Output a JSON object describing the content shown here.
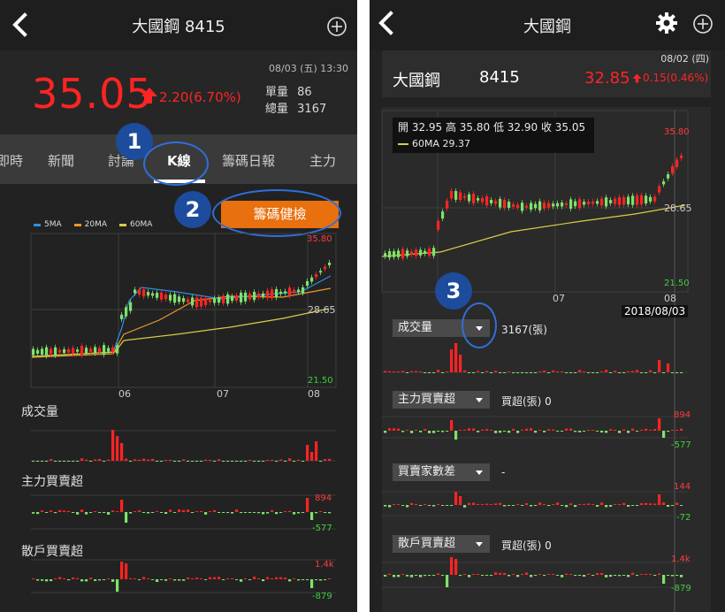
{
  "left": {
    "header": {
      "title": "大國鋼 8415"
    },
    "quote": {
      "price": "35.05",
      "change": "2.20(6.70%)",
      "datetime": "08/03 (五) 13:30",
      "unit_volume_label": "單量",
      "unit_volume": "86",
      "total_volume_label": "總量",
      "total_volume": "3167"
    },
    "tabs": [
      {
        "label": "即時"
      },
      {
        "label": "新聞"
      },
      {
        "label": "討論"
      },
      {
        "label": "K線"
      },
      {
        "label": "籌碼日報"
      },
      {
        "label": "主力"
      }
    ],
    "badges": [
      "1",
      "2"
    ],
    "chip_check_button": "籌碼健檢",
    "legend": [
      "5MA",
      "20MA",
      "60MA"
    ],
    "price_axis": {
      "high": "35.80",
      "mid": "28.65",
      "low": "21.50"
    },
    "x_ticks": [
      "06",
      "07",
      "08"
    ],
    "sections": [
      "成交量",
      "主力買賣超",
      "散戶買賣超"
    ],
    "main_force_axis": {
      "high": "894",
      "low": "-577"
    },
    "retail_axis": {
      "high": "1.4k",
      "low": "-879"
    }
  },
  "right": {
    "header": {
      "title": "大國鋼"
    },
    "info": {
      "date": "08/02 (四)",
      "name": "大國鋼",
      "code": "8415",
      "price": "32.85",
      "change": "0.15(0.46%)"
    },
    "ohlc": "開 32.95 高 35.80 低 32.90 收 35.05",
    "ma60": "60MA 29.37",
    "price_axis": {
      "high": "35.80",
      "mid": "28.65",
      "low": "21.50"
    },
    "x_ticks": [
      "07",
      "08"
    ],
    "badge": "3",
    "date_tag": "2018/08/03",
    "volume_dropdown": {
      "label": "成交量",
      "value": "3167(張)"
    },
    "main_force_dropdown": {
      "label": "主力買賣超",
      "value": "買超(張) 0",
      "high": "894",
      "low": "-577"
    },
    "brokers_dropdown": {
      "label": "買賣家數差",
      "value": "-",
      "high": "144",
      "low": "-72"
    },
    "retail_dropdown": {
      "label": "散戶買賣超",
      "value": "買超(張) 0",
      "high": "1.4k",
      "low": "-879"
    }
  },
  "colors": {
    "up": "#ff2424",
    "down": "#7ee36a",
    "ma5": "#2f8fe8",
    "ma20": "#e89a2a",
    "ma60": "#d7cd48",
    "accent": "#e8700e",
    "badge": "#1d4c9c"
  },
  "icons": [
    "back-icon",
    "add-circle-icon",
    "gear-icon",
    "arrow-up-icon",
    "caret-down-icon"
  ]
}
